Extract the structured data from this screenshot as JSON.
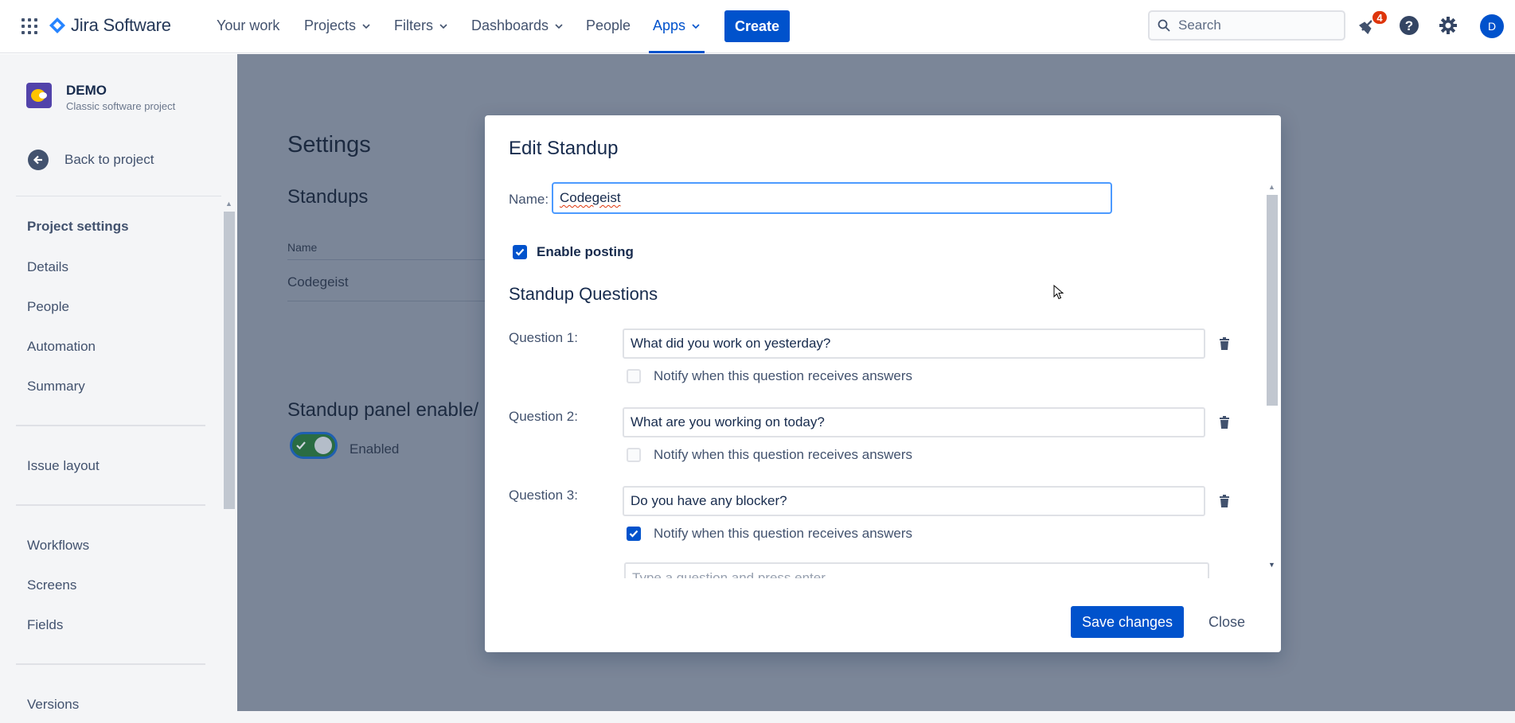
{
  "topnav": {
    "product": "Jira Software",
    "items": [
      {
        "label": "Your work",
        "has_menu": false
      },
      {
        "label": "Projects",
        "has_menu": true
      },
      {
        "label": "Filters",
        "has_menu": true
      },
      {
        "label": "Dashboards",
        "has_menu": true
      },
      {
        "label": "People",
        "has_menu": false
      },
      {
        "label": "Apps",
        "has_menu": true,
        "active": true
      }
    ],
    "create_label": "Create",
    "search_placeholder": "Search",
    "notification_count": "4",
    "avatar_initial": "D",
    "accent_color": "#0052cc"
  },
  "sidebar": {
    "project_name": "DEMO",
    "project_type": "Classic software project",
    "back_label": "Back to project",
    "heading": "Project settings",
    "items": [
      "Details",
      "People",
      "Automation",
      "Summary",
      "Issue layout",
      "Workflows",
      "Screens",
      "Fields",
      "Versions"
    ]
  },
  "background": {
    "title": "Settings",
    "subtitle": "Standups",
    "table_header": "Name",
    "table_row": "Codegeist",
    "panel_heading": "Standup panel enable/",
    "toggle_label": "Enabled"
  },
  "modal": {
    "title": "Edit Standup",
    "name_label": "Name:",
    "name_value": "Codegeist",
    "enable_posting_label": "Enable posting",
    "enable_posting_checked": true,
    "questions_title": "Standup Questions",
    "questions": [
      {
        "label": "Question 1:",
        "value": "What did you work on yesterday?",
        "notify": false
      },
      {
        "label": "Question 2:",
        "value": "What are you working on today?",
        "notify": false
      },
      {
        "label": "Question 3:",
        "value": "Do you have any blocker?",
        "notify": true
      }
    ],
    "notify_label": "Notify when this question receives answers",
    "new_question_placeholder": "Type a question and press enter",
    "save_label": "Save changes",
    "close_label": "Close"
  }
}
